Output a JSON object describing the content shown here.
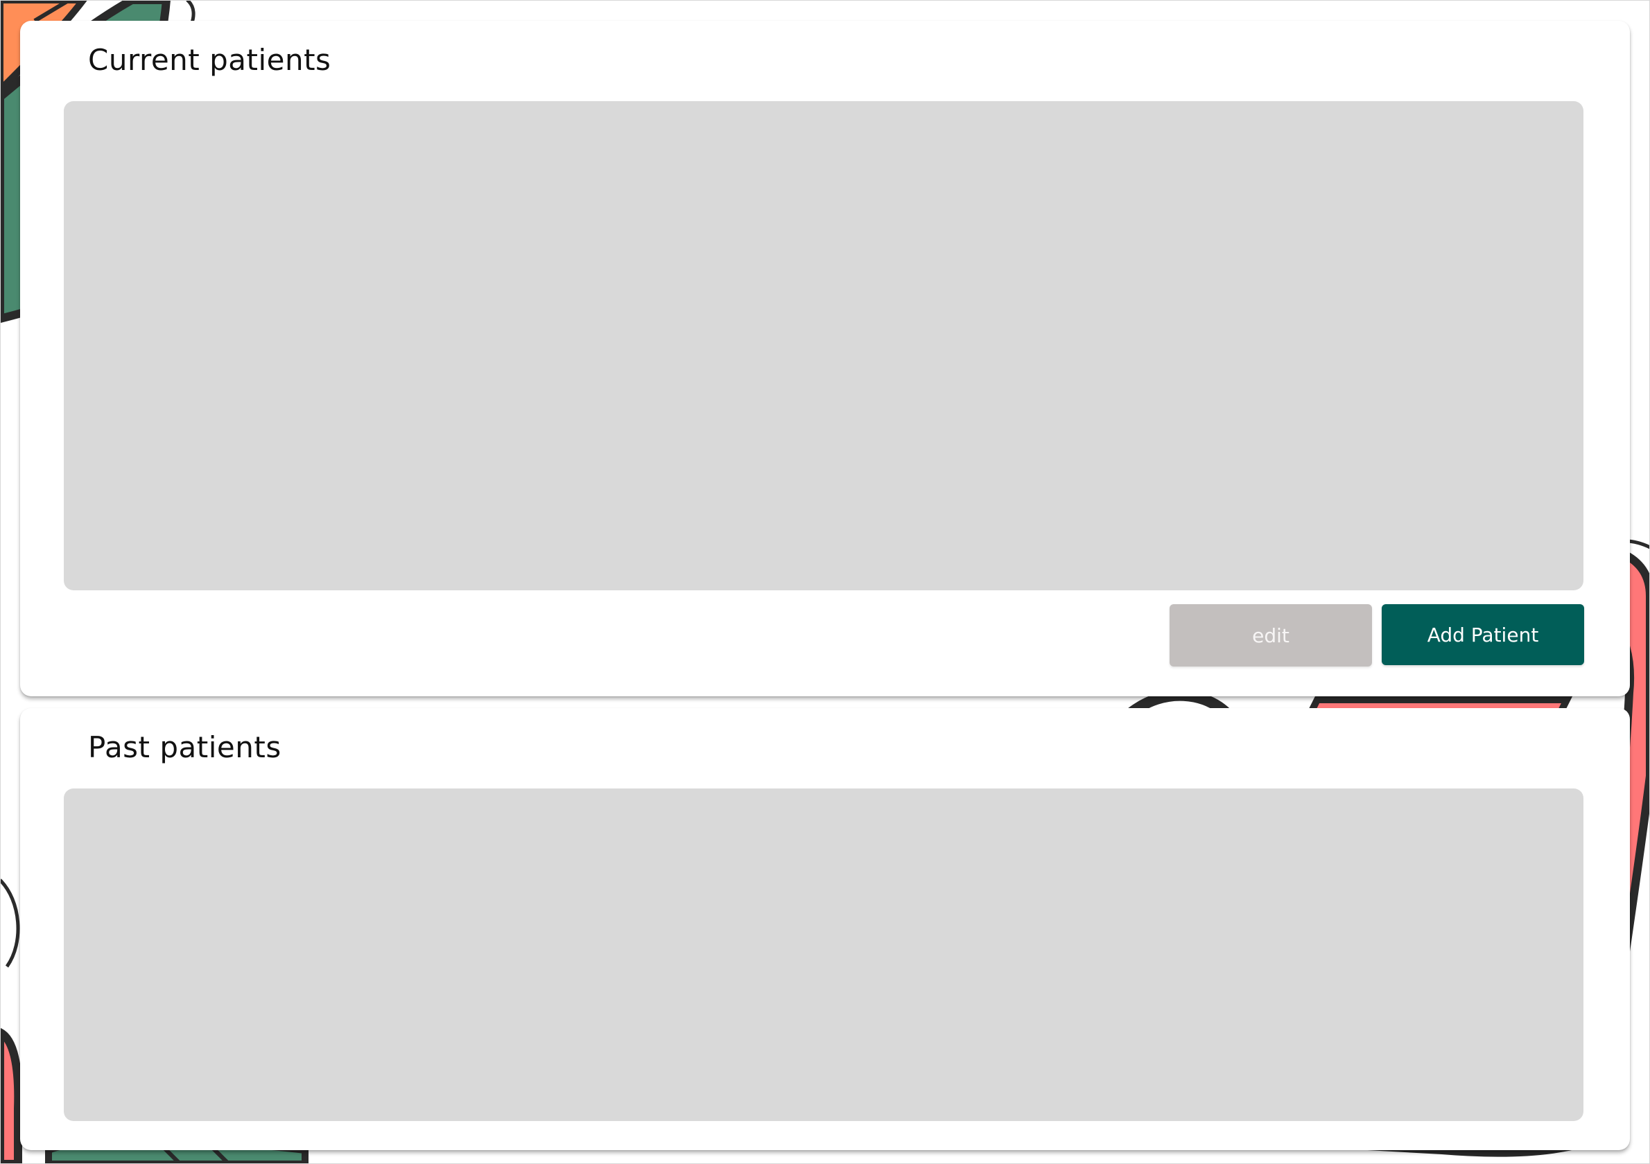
{
  "current_patients": {
    "title": "Current patients",
    "edit_label": "edit",
    "add_label": "Add Patient"
  },
  "past_patients": {
    "title": "Past patients"
  },
  "colors": {
    "primary_button": "#015e58",
    "disabled_button": "#c3bfbe",
    "placeholder": "#d9d9d9",
    "decor_orange": "#ff8e57",
    "decor_green": "#4a8a6f",
    "decor_coral": "#ff7778"
  }
}
